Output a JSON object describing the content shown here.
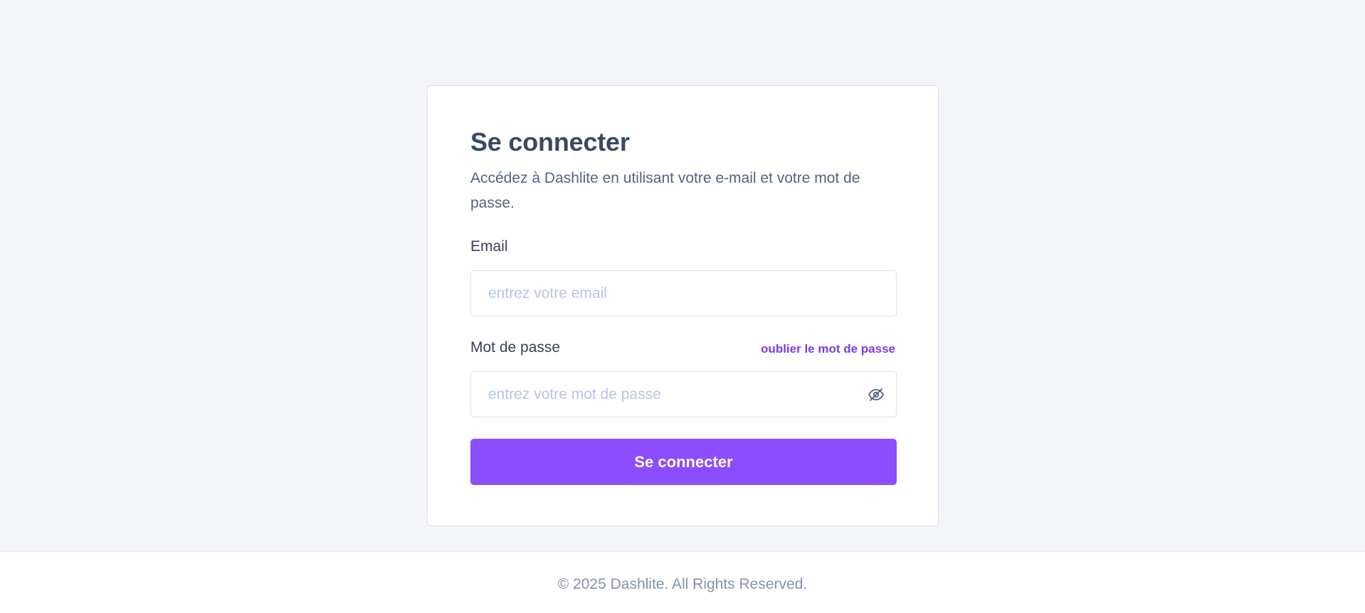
{
  "login": {
    "title": "Se connecter",
    "subtitle": "Accédez à Dashlite en utilisant votre e-mail et votre mot de passe.",
    "email_label": "Email",
    "email_placeholder": "entrez votre email",
    "password_label": "Mot de passe",
    "forgot_link": "oublier le mot de passe",
    "password_placeholder": "entrez votre mot de passe",
    "password_toggle_icon": "eye-off-icon",
    "submit_label": "Se connecter"
  },
  "footer": {
    "copyright": "© 2025 Dashlite. All Rights Reserved."
  },
  "colors": {
    "accent": "#8b4dfd",
    "link": "#7c3aed",
    "heading": "#364a63",
    "page_bg": "#f4f5f9"
  }
}
